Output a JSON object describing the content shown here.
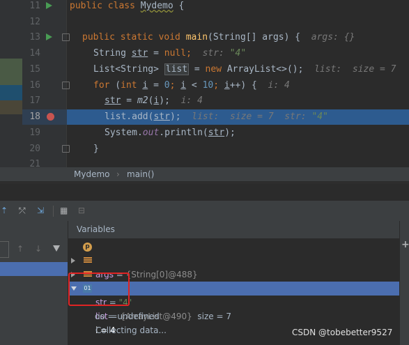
{
  "editor": {
    "lines": [
      {
        "n": "11"
      },
      {
        "n": "12"
      },
      {
        "n": "13"
      },
      {
        "n": "14"
      },
      {
        "n": "15"
      },
      {
        "n": "16"
      },
      {
        "n": "17"
      },
      {
        "n": "18"
      },
      {
        "n": "19"
      },
      {
        "n": "20"
      },
      {
        "n": "21"
      }
    ],
    "code": {
      "l11_kw": "public class ",
      "l11_cls": "Mydemo",
      "l11_rest": " {",
      "l13_kw": "public static void ",
      "l13_fn": "main",
      "l13_rest": "(String[] args) {",
      "l13_hint": "args: {}",
      "l14_a": "String ",
      "l14_var": "str",
      "l14_b": " = ",
      "l14_null": "null",
      "l14_c": ";",
      "l14_hint": "str: ",
      "l14_hint_val": "\"4\"",
      "l15_a": "List<String> ",
      "l15_var": "list",
      "l15_b": " = ",
      "l15_new": "new",
      "l15_c": " ArrayList<>();",
      "l15_hint": "list:  size = 7",
      "l16_for": "for",
      "l16_a": " (",
      "l16_int": "int",
      "l16_b": " ",
      "l16_i": "i",
      "l16_c": " = ",
      "l16_0": "0",
      "l16_d": "; ",
      "l16_i2": "i",
      "l16_e": " < ",
      "l16_10": "10",
      "l16_f": "; ",
      "l16_i3": "i",
      "l16_g": "++) {",
      "l16_hint": "i: 4",
      "l17_var": "str",
      "l17_a": " = ",
      "l17_fn": "m2",
      "l17_b": "(",
      "l17_i": "i",
      "l17_c": ");",
      "l17_hint": "i: 4",
      "l18_a": "list.add(",
      "l18_var": "str",
      "l18_b": ");",
      "l18_hint": "list:  size = 7  str: ",
      "l18_hint_val": "\"4\"",
      "l19_a": "System.",
      "l19_out": "out",
      "l19_b": ".println(",
      "l19_var": "str",
      "l19_c": ");",
      "l20": "}"
    }
  },
  "breadcrumb": {
    "class": "Mydemo",
    "sep": "›",
    "method": "main()"
  },
  "toolbar": {
    "icons": [
      "step-out-icon",
      "drop-frame-icon",
      "run-to-cursor-icon",
      "evaluate-icon",
      "table-icon"
    ]
  },
  "variables": {
    "header": "Variables",
    "rows": [
      {
        "name": "args",
        "eq": " = ",
        "value": "{String[0]@488}",
        "icon": "parameter-icon"
      },
      {
        "name": "str",
        "eq": " = ",
        "value": "\"4\"",
        "icon": "field-icon"
      },
      {
        "name": "list",
        "eq": " = ",
        "value": "{ArrayList@490}",
        "extra": "  size = 7",
        "icon": "field-icon"
      },
      {
        "name": "i",
        "eq": " = ",
        "value": "4",
        "icon": "primitive-icon",
        "icon_text": "01"
      },
      {
        "name": "oo",
        "eq": " = ",
        "value": "undefined"
      },
      {
        "status": "Collecting data..."
      }
    ]
  },
  "watermark": "CSDN @tobebetter9527",
  "colors": {
    "keyword": "#cc7832",
    "number": "#6897bb",
    "function": "#ffc66d",
    "string": "#6a8759",
    "selection": "#4b6eaf",
    "breakpoint": "#c75450",
    "annotation_box": "#e02424"
  }
}
